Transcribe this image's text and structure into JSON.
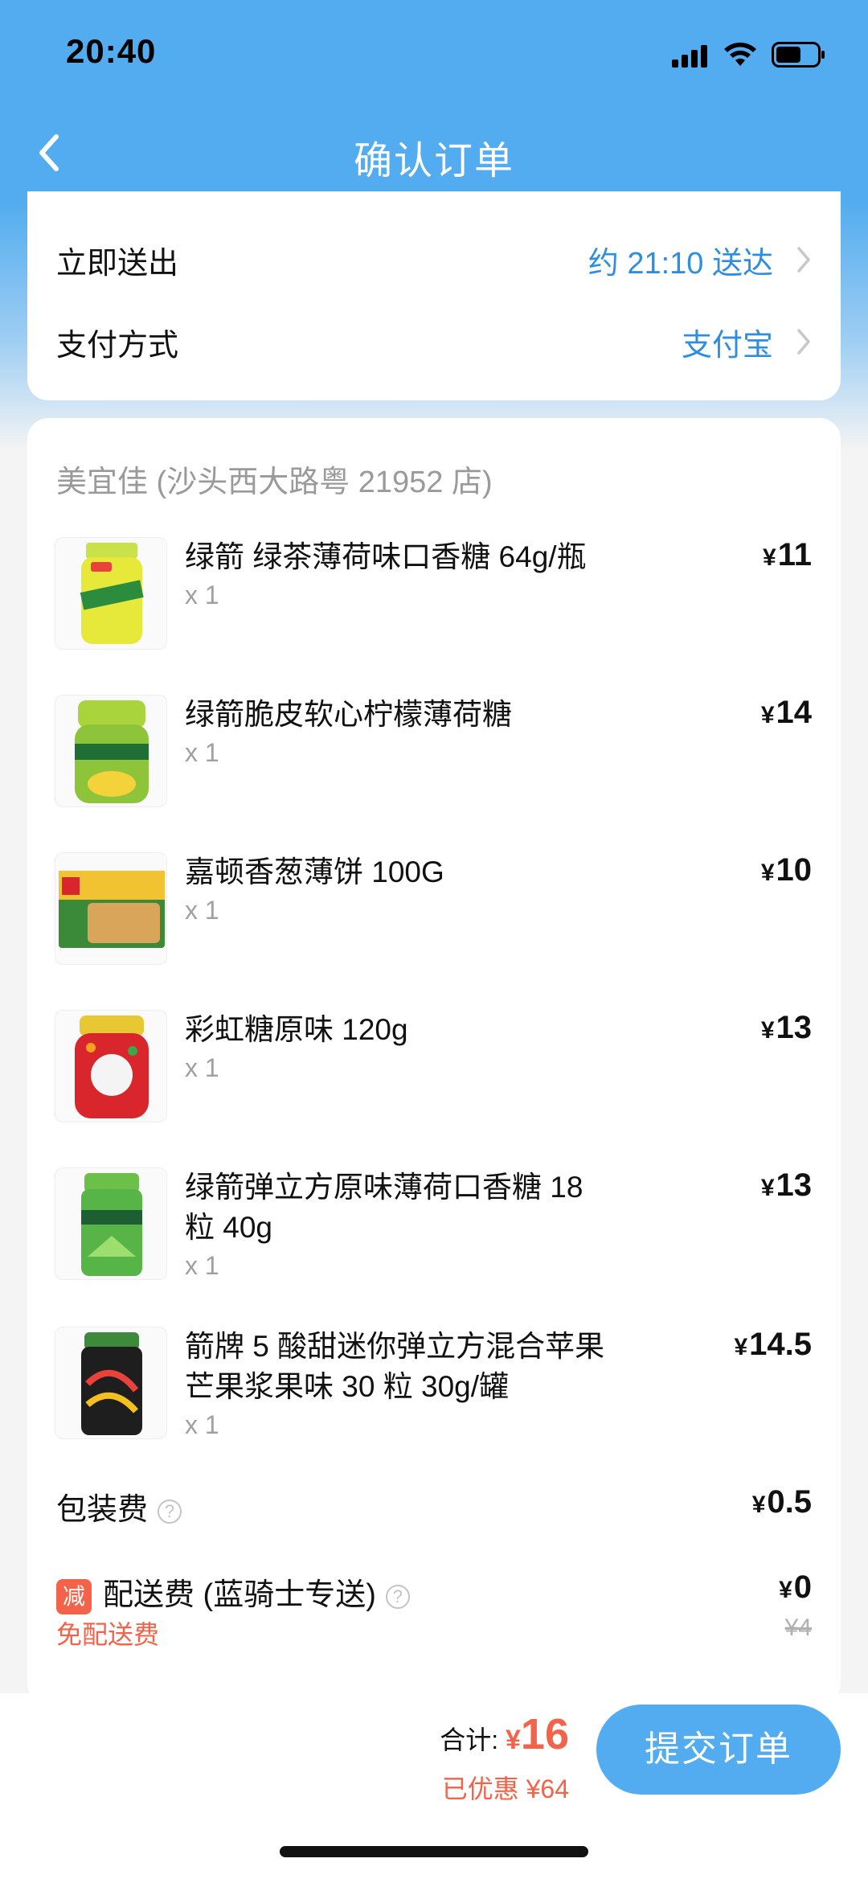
{
  "status_bar": {
    "time": "20:40"
  },
  "nav": {
    "title": "确认订单",
    "back_icon": "chevron-left-icon"
  },
  "delivery": {
    "dispatch_label": "立即送出",
    "dispatch_value": "约 21:10 送达",
    "payment_label": "支付方式",
    "payment_value": "支付宝"
  },
  "order": {
    "store_name": "美宜佳 (沙头西大路粤 21952 店)",
    "items": [
      {
        "name": "绿箭 绿茶薄荷味口香糖 64g/瓶",
        "qty": "x 1",
        "price": "11"
      },
      {
        "name": "绿箭脆皮软心柠檬薄荷糖",
        "qty": "x 1",
        "price": "14"
      },
      {
        "name": "嘉顿香葱薄饼 100G",
        "qty": "x 1",
        "price": "10"
      },
      {
        "name": "彩虹糖原味 120g",
        "qty": "x 1",
        "price": "13"
      },
      {
        "name": "绿箭弹立方原味薄荷口香糖 18 粒 40g",
        "qty": "x 1",
        "price": "13"
      },
      {
        "name": "箭牌 5 酸甜迷你弹立方混合苹果芒果浆果味 30 粒 30g/罐",
        "qty": "x 1",
        "price": "14.5"
      }
    ],
    "packing_fee_label": "包装费",
    "packing_fee": "0.5",
    "delivery_fee_badge": "减",
    "delivery_fee_label": "配送费 (蓝骑士专送)",
    "delivery_fee": "0",
    "delivery_fee_original": "¥4",
    "free_delivery_text": "免配送费"
  },
  "footer": {
    "total_label": "合计: ",
    "total_value": "16",
    "discount_text": "已优惠 ¥64",
    "submit_label": "提交订单"
  },
  "currency": "¥",
  "colors": {
    "brand_blue": "#52acef",
    "link_blue": "#2f8ee0",
    "accent_red": "#f2634a"
  }
}
